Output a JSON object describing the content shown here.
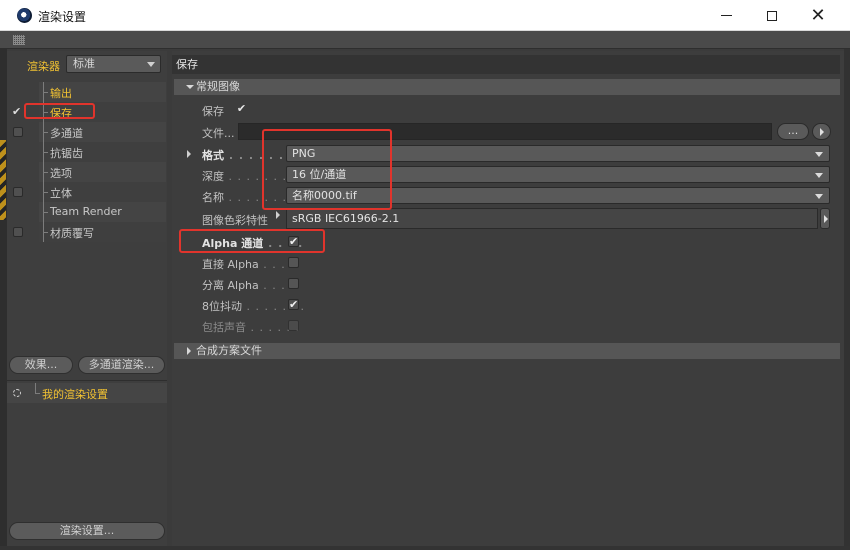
{
  "window": {
    "title": "渲染设置"
  },
  "left_panel": {
    "renderer_label": "渲染器",
    "renderer_value": "标准",
    "tree": [
      {
        "label": "输出",
        "checked": null,
        "color": "yellow"
      },
      {
        "label": "保存",
        "checked": true,
        "color": "yellow"
      },
      {
        "label": "多通道",
        "checked": false,
        "color": "normal"
      },
      {
        "label": "抗锯齿",
        "checked": null,
        "color": "normal"
      },
      {
        "label": "选项",
        "checked": null,
        "color": "normal"
      },
      {
        "label": "立体",
        "checked": false,
        "color": "normal"
      },
      {
        "label": "Team Render",
        "checked": null,
        "color": "normal"
      },
      {
        "label": "材质覆写",
        "checked": false,
        "color": "normal"
      }
    ],
    "effects_button": "效果...",
    "multipass_button": "多通道渲染...",
    "my_settings": "我的渲染设置",
    "render_settings_button": "渲染设置..."
  },
  "right_panel": {
    "section_title": "保存",
    "group_regular": "常规图像",
    "save_label": "保存",
    "file_label": "文件...",
    "file_value": "",
    "browse_button": "...",
    "format_label": "格式",
    "format_value": "PNG",
    "depth_label": "深度",
    "depth_value": "16 位/通道",
    "name_label": "名称",
    "name_value": "名称0000.tif",
    "color_profile_label": "图像色彩特性",
    "color_profile_value": "sRGB IEC61966-2.1",
    "alpha_label": "Alpha 通道",
    "alpha_checked": true,
    "straight_alpha_label": "直接 Alpha",
    "straight_alpha_checked": false,
    "separate_alpha_label": "分离 Alpha",
    "separate_alpha_checked": false,
    "dither_label": "8位抖动",
    "dither_checked": true,
    "include_sound_label": "包括声音",
    "include_sound_checked": false,
    "group_compositing": "合成方案文件"
  },
  "colors": {
    "highlight_red": "#e1342c",
    "accent_yellow": "#f2c232"
  }
}
